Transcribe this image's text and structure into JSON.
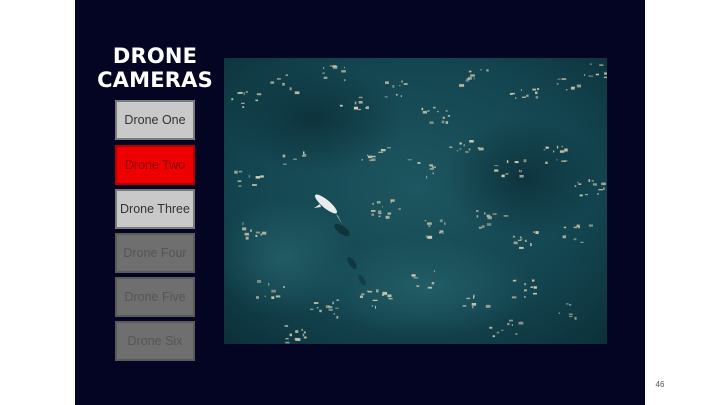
{
  "title": {
    "line1": "DRONE",
    "line2": "CAMERAS"
  },
  "drones": [
    {
      "label": "Drone One",
      "state": "available"
    },
    {
      "label": "Drone Two",
      "state": "selected"
    },
    {
      "label": "Drone Three",
      "state": "available"
    },
    {
      "label": "Drone Four",
      "state": "disabled"
    },
    {
      "label": "Drone Five",
      "state": "disabled"
    },
    {
      "label": "Drone Six",
      "state": "disabled"
    }
  ],
  "page_number": "46",
  "colors": {
    "panel_background": "#030523",
    "selected": "#ee0000",
    "available": "#c9c9c9",
    "disabled": "#6f6f6f",
    "ocean": "#123f48"
  }
}
